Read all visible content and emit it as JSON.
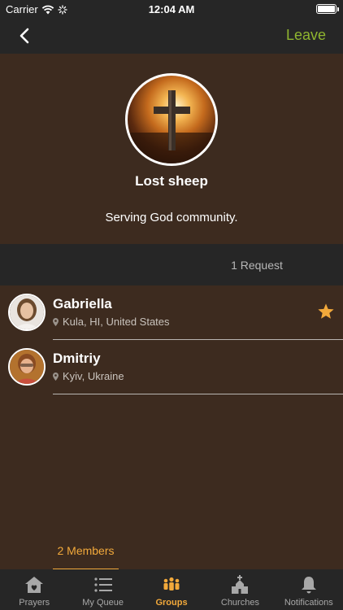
{
  "status_bar": {
    "carrier": "Carrier",
    "time": "12:04 AM"
  },
  "nav": {
    "leave_label": "Leave"
  },
  "group": {
    "name": "Lost sheep",
    "description": "Serving God community."
  },
  "tabs": {
    "members_label": "2 Members",
    "requests_label": "1 Request"
  },
  "members": [
    {
      "name": "Gabriella",
      "location": "Kula, HI, United States",
      "starred": true
    },
    {
      "name": "Dmitriy",
      "location": "Kyiv, Ukraine",
      "starred": false
    }
  ],
  "tab_bar": [
    {
      "label": "Prayers",
      "icon": "house-icon",
      "active": false
    },
    {
      "label": "My Queue",
      "icon": "list-icon",
      "active": false
    },
    {
      "label": "Groups",
      "icon": "people-icon",
      "active": true
    },
    {
      "label": "Churches",
      "icon": "church-icon",
      "active": false
    },
    {
      "label": "Notifications",
      "icon": "bell-icon",
      "active": false
    }
  ],
  "colors": {
    "background": "#3d2b1f",
    "bars": "#262626",
    "accent": "#f2a93b",
    "leave": "#8fb52f"
  }
}
